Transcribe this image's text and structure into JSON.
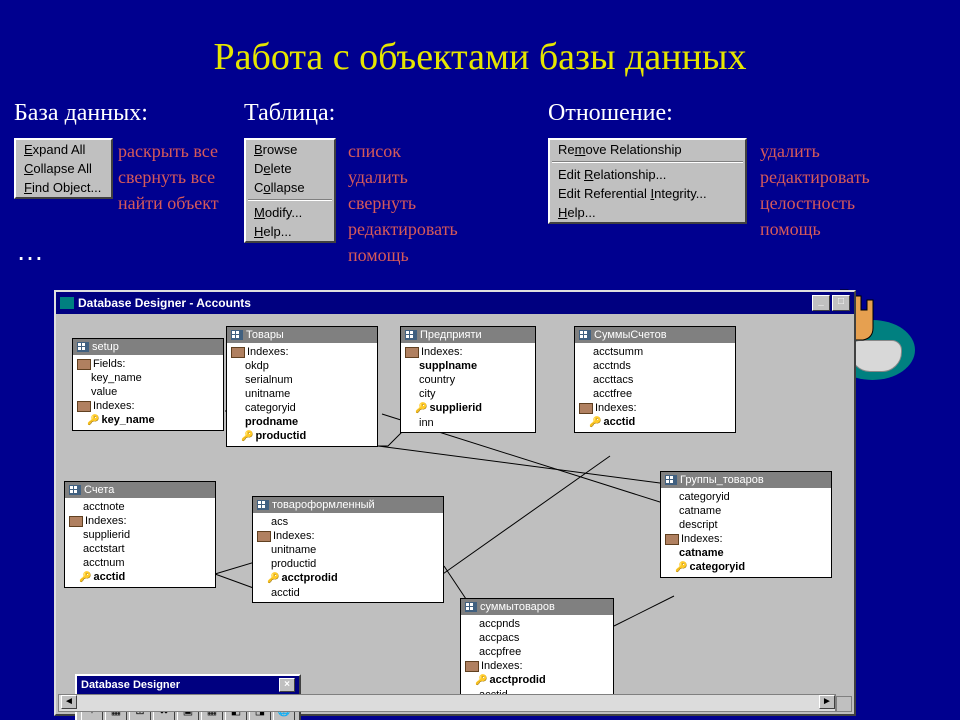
{
  "title": "Работа с объектами базы данных",
  "sections": {
    "db": "База данных:",
    "table": "Таблица:",
    "rel": "Отношение:"
  },
  "menu_db": {
    "expand": "Expand All",
    "collapse": "Collapse All",
    "find": "Find Object..."
  },
  "ru_db": {
    "expand": "раскрыть все",
    "collapse": "свернуть все",
    "find": "найти объект"
  },
  "menu_tbl": {
    "browse": "Browse",
    "delete": "Delete",
    "collapse": "Collapse",
    "modify": "Modify...",
    "help": "Help..."
  },
  "ru_tbl": {
    "browse": "список",
    "delete": "удалить",
    "collapse": "свернуть",
    "modify": "редактировать",
    "help": "помощь"
  },
  "menu_rel": {
    "remove": "Remove Relationship",
    "edit": "Edit Relationship...",
    "integrity": "Edit Referential Integrity...",
    "help": "Help..."
  },
  "ru_rel": {
    "remove": "удалить",
    "edit": "редактировать",
    "integrity": "целостность",
    "help": "помощь"
  },
  "ellipsis": "…",
  "designer_title": "Database Designer - Accounts",
  "palette_title": "Database Designer",
  "tables": {
    "setup": {
      "name": "setup",
      "fields_lbl": "Fields:",
      "f1": "key_name",
      "f2": "value",
      "idx_lbl": "Indexes:",
      "k1": "key_name"
    },
    "tovary": {
      "name": "Товары",
      "idx_lbl": "Indexes:",
      "f1": "okdp",
      "f2": "serialnum",
      "f3": "unitname",
      "f4": "categoryid",
      "f5": "prodname",
      "k1": "productid"
    },
    "predpr": {
      "name": "Предприяти",
      "idx_lbl": "Indexes:",
      "f1": "supplname",
      "f2": "country",
      "f3": "city",
      "k1": "supplierid",
      "f4": "inn"
    },
    "sumsch": {
      "name": "СуммыСчетов",
      "f1": "acctsumm",
      "f2": "acctnds",
      "f3": "accttacs",
      "f4": "acctfree",
      "idx_lbl": "Indexes:",
      "k1": "acctid"
    },
    "scheta": {
      "name": "Счета",
      "f1": "acctnote",
      "idx_lbl": "Indexes:",
      "f2": "supplierid",
      "f3": "acctstart",
      "f4": "acctnum",
      "k1": "acctid"
    },
    "tovoform": {
      "name": "товароформленный",
      "f1": "acs",
      "idx_lbl": "Indexes:",
      "f2": "unitname",
      "f3": "productid",
      "k1": "acctprodid",
      "f4": "acctid"
    },
    "sumtov": {
      "name": "суммытоваров",
      "f1": "accpnds",
      "f2": "accpacs",
      "f3": "accpfree",
      "idx_lbl": "Indexes:",
      "k1": "acctprodid",
      "f4": "acctid"
    },
    "grptov": {
      "name": "Группы_товаров",
      "f1": "categoryid",
      "f2": "catname",
      "f3": "descript",
      "idx_lbl": "Indexes:",
      "k1": "catname",
      "k2": "categoryid"
    }
  }
}
